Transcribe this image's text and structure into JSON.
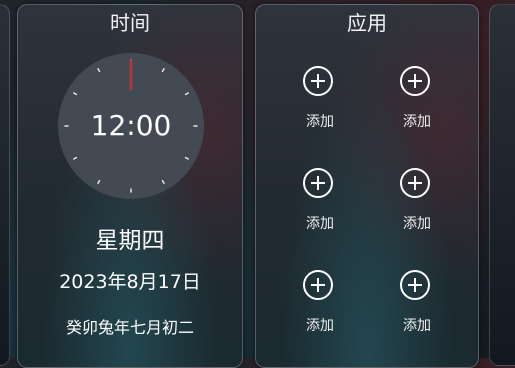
{
  "time_card": {
    "title": "时间",
    "clock_time": "12:00",
    "clock_progress_note": "analog clock hands at 12:00",
    "weekday": "星期四",
    "date": "2023年8月17日",
    "lunar_date": "癸卯兔年七月初二"
  },
  "apps_card": {
    "title": "应用",
    "slots": [
      {
        "label": "添加"
      },
      {
        "label": "添加"
      },
      {
        "label": "添加"
      },
      {
        "label": "添加"
      },
      {
        "label": "添加"
      },
      {
        "label": "添加"
      }
    ]
  },
  "colors": {
    "clock_face": "#444a53",
    "second_hand": "#c0303a"
  }
}
